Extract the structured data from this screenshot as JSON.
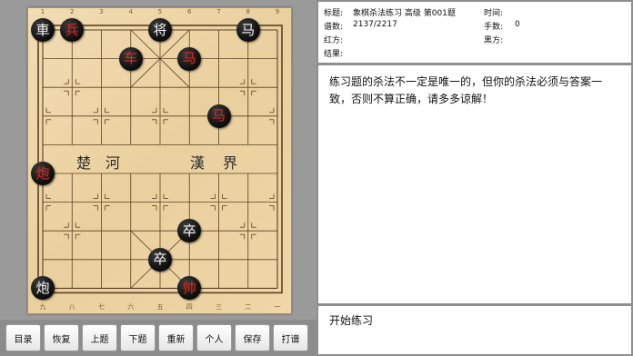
{
  "board": {
    "file_labels_top": [
      "1",
      "2",
      "3",
      "4",
      "5",
      "6",
      "7",
      "8",
      "9"
    ],
    "file_labels_bottom": [
      "九",
      "八",
      "七",
      "六",
      "五",
      "四",
      "三",
      "二",
      "一"
    ],
    "river_left": [
      "楚",
      "河"
    ],
    "river_right": [
      "漢",
      "界"
    ],
    "pieces": [
      {
        "char": "車",
        "color": "black",
        "file": 0,
        "rank": 0
      },
      {
        "char": "兵",
        "color": "red",
        "file": 1,
        "rank": 0
      },
      {
        "char": "将",
        "color": "black",
        "file": 4,
        "rank": 0
      },
      {
        "char": "马",
        "color": "black",
        "file": 7,
        "rank": 0
      },
      {
        "char": "车",
        "color": "red",
        "file": 3,
        "rank": 1
      },
      {
        "char": "马",
        "color": "red",
        "file": 5,
        "rank": 1
      },
      {
        "char": "马",
        "color": "red",
        "file": 6,
        "rank": 3
      },
      {
        "char": "炮",
        "color": "red",
        "file": 0,
        "rank": 5
      },
      {
        "char": "卒",
        "color": "black",
        "file": 5,
        "rank": 7
      },
      {
        "char": "卒",
        "color": "black",
        "file": 4,
        "rank": 8
      },
      {
        "char": "炮",
        "color": "black",
        "file": 0,
        "rank": 9
      },
      {
        "char": "帅",
        "color": "red",
        "file": 5,
        "rank": 9
      }
    ]
  },
  "buttons": [
    "目录",
    "恢复",
    "上题",
    "下题",
    "重新",
    "个人",
    "保存",
    "打谱"
  ],
  "info": {
    "title_label": "标题:",
    "title_value": "象棋杀法练习 高级 第001题",
    "time_label": "时间:",
    "time_value": "",
    "count_label": "谱数:",
    "count_value": "2137/2217",
    "moves_label": "手数:",
    "moves_value": "0",
    "red_label": "红方:",
    "red_value": "",
    "black_label": "黑方:",
    "black_value": "",
    "result_label": "结果:",
    "result_value": ""
  },
  "description": "练习题的杀法不一定是唯一的，但你的杀法必须与答案一致，否则不算正确，请多多谅解！",
  "status": "开始练习",
  "colors": {
    "red_piece": "#e0281e",
    "black_piece": "#111111",
    "board": "#ead09e",
    "line": "#5a4020"
  }
}
